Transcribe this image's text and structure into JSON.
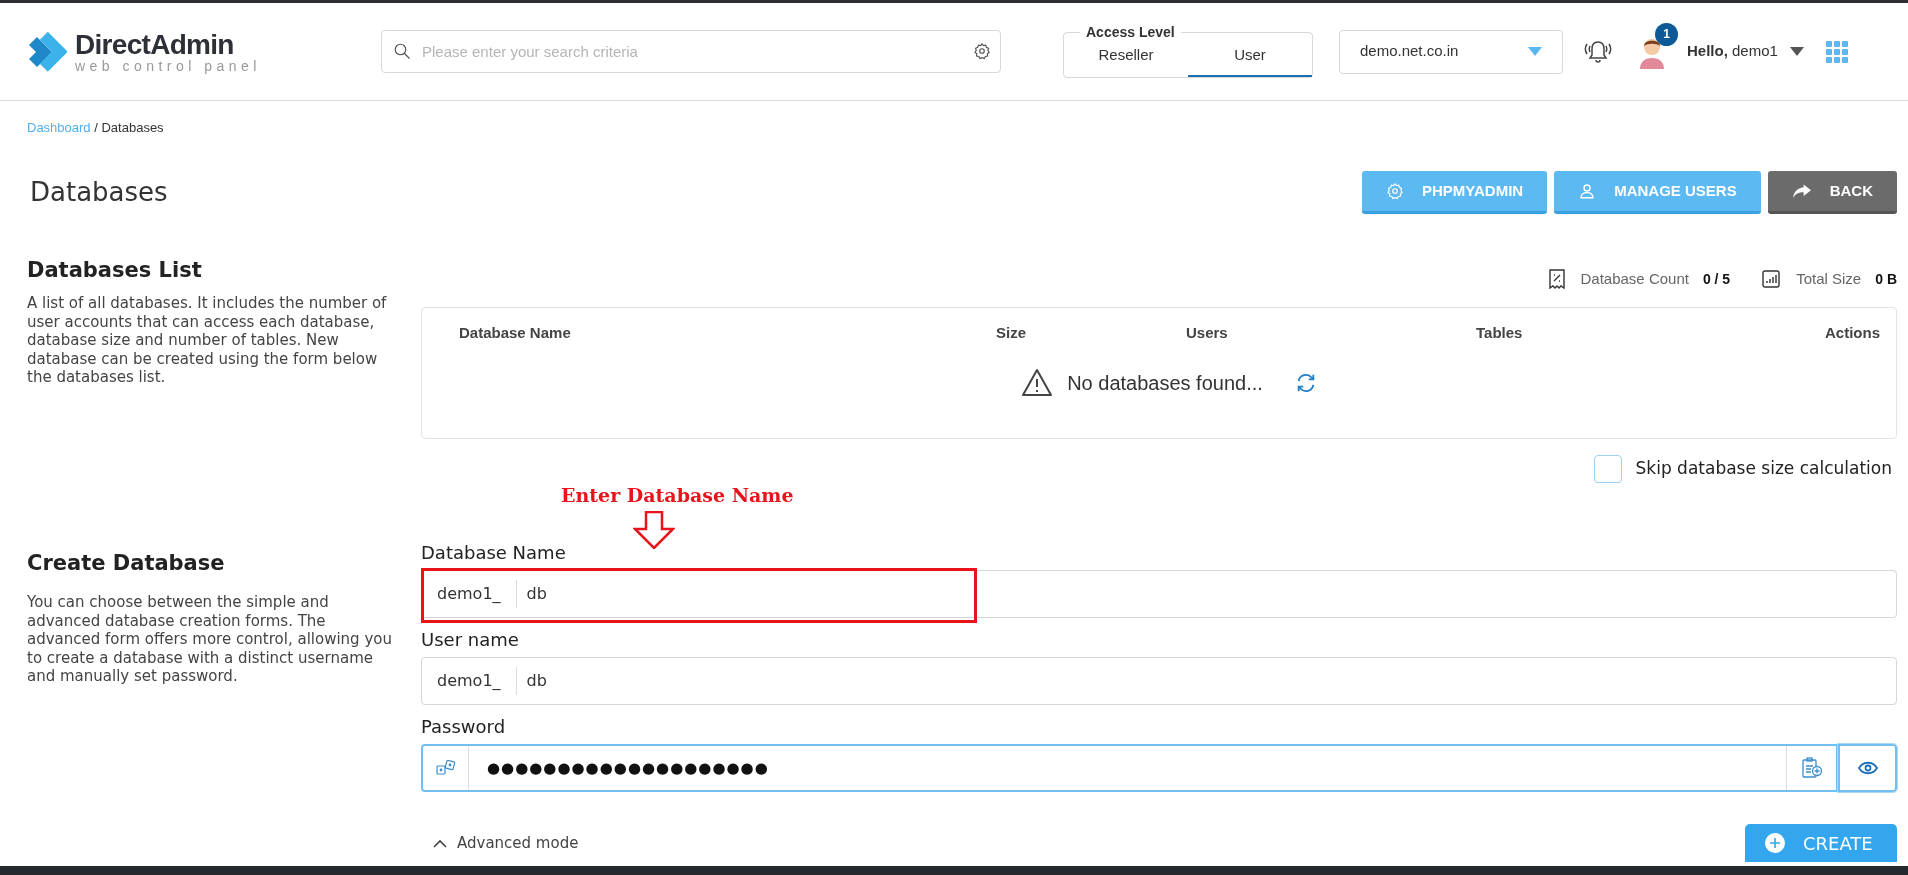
{
  "logo": {
    "name": "DirectAdmin",
    "tagline": "web control panel"
  },
  "search": {
    "placeholder": "Please enter your search criteria"
  },
  "access_level": {
    "label": "Access Level",
    "tabs": [
      {
        "label": "Reseller",
        "selected": false
      },
      {
        "label": "User",
        "selected": true
      }
    ]
  },
  "domain_select": {
    "value": "demo.net.co.in"
  },
  "user_menu": {
    "badge": "1",
    "greeting": "**Hello,** demo1"
  },
  "breadcrumb": {
    "link": "Dashboard",
    "current": "/ Databases"
  },
  "page_title": "Databases",
  "actions": [
    {
      "label": "PHPMYADMIN",
      "kind": "primary"
    },
    {
      "label": "MANAGE USERS",
      "kind": "primary"
    },
    {
      "label": "BACK",
      "kind": "secondary"
    }
  ],
  "databases_list": {
    "title": "Databases List",
    "description": "A list of all databases. It includes the number of user accounts that can access each database, database size and number of tables. New database can be created using the form below the databases list.",
    "stats": [
      {
        "label": "Database Count",
        "value": "0 / 5"
      },
      {
        "label": "Total Size",
        "value": "0 B"
      }
    ],
    "table": {
      "columns": [
        "Database Name",
        "Size",
        "Users",
        "Tables",
        "Actions"
      ],
      "empty_message": "No databases found..."
    },
    "skip_size": {
      "label": "Skip database size calculation",
      "checked": false
    }
  },
  "annotation": {
    "text": "Enter Database Name"
  },
  "create_database": {
    "title": "Create Database",
    "description": "You can choose between the simple and advanced database creation forms. The advanced form offers more control, allowing you to create a database with a distinct username and manually set password.",
    "fields": [
      {
        "kind": "prefixed",
        "label": "Database Name",
        "prefix": "demo1_",
        "value": "db",
        "annotated": true
      },
      {
        "kind": "prefixed",
        "label": "User name",
        "prefix": "demo1_",
        "value": "db",
        "annotated": false
      },
      {
        "kind": "password",
        "label": "Password",
        "value": "●●●●●●●●●●●●●●●●●●●●",
        "focused": true
      }
    ],
    "advanced_toggle": "Advanced mode",
    "create_button": "CREATE"
  }
}
